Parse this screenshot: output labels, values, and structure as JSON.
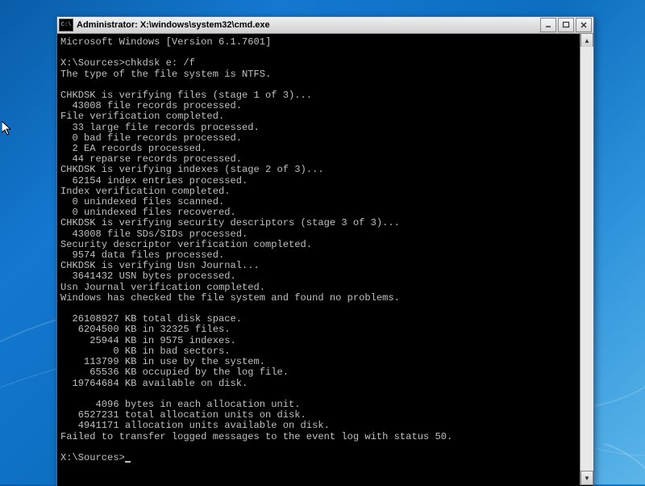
{
  "window": {
    "title": "Administrator: X:\\windows\\system32\\cmd.exe",
    "icon_label": "C:\\"
  },
  "console": {
    "header": "Microsoft Windows [Version 6.1.7601]",
    "prompt_initial": "X:\\Sources>",
    "command": "chkdsk e: /f",
    "lines": [
      "The type of the file system is NTFS.",
      "",
      "CHKDSK is verifying files (stage 1 of 3)...",
      "  43008 file records processed.",
      "File verification completed.",
      "  33 large file records processed.",
      "  0 bad file records processed.",
      "  2 EA records processed.",
      "  44 reparse records processed.",
      "CHKDSK is verifying indexes (stage 2 of 3)...",
      "  62154 index entries processed.",
      "Index verification completed.",
      "  0 unindexed files scanned.",
      "  0 unindexed files recovered.",
      "CHKDSK is verifying security descriptors (stage 3 of 3)...",
      "  43008 file SDs/SIDs processed.",
      "Security descriptor verification completed.",
      "  9574 data files processed.",
      "CHKDSK is verifying Usn Journal...",
      "  3641432 USN bytes processed.",
      "Usn Journal verification completed.",
      "Windows has checked the file system and found no problems.",
      "",
      "  26108927 KB total disk space.",
      "   6204500 KB in 32325 files.",
      "     25944 KB in 9575 indexes.",
      "         0 KB in bad sectors.",
      "    113799 KB in use by the system.",
      "     65536 KB occupied by the log file.",
      "  19764684 KB available on disk.",
      "",
      "      4096 bytes in each allocation unit.",
      "   6527231 total allocation units on disk.",
      "   4941171 allocation units available on disk.",
      "Failed to transfer logged messages to the event log with status 50."
    ],
    "prompt_final": "X:\\Sources>"
  }
}
